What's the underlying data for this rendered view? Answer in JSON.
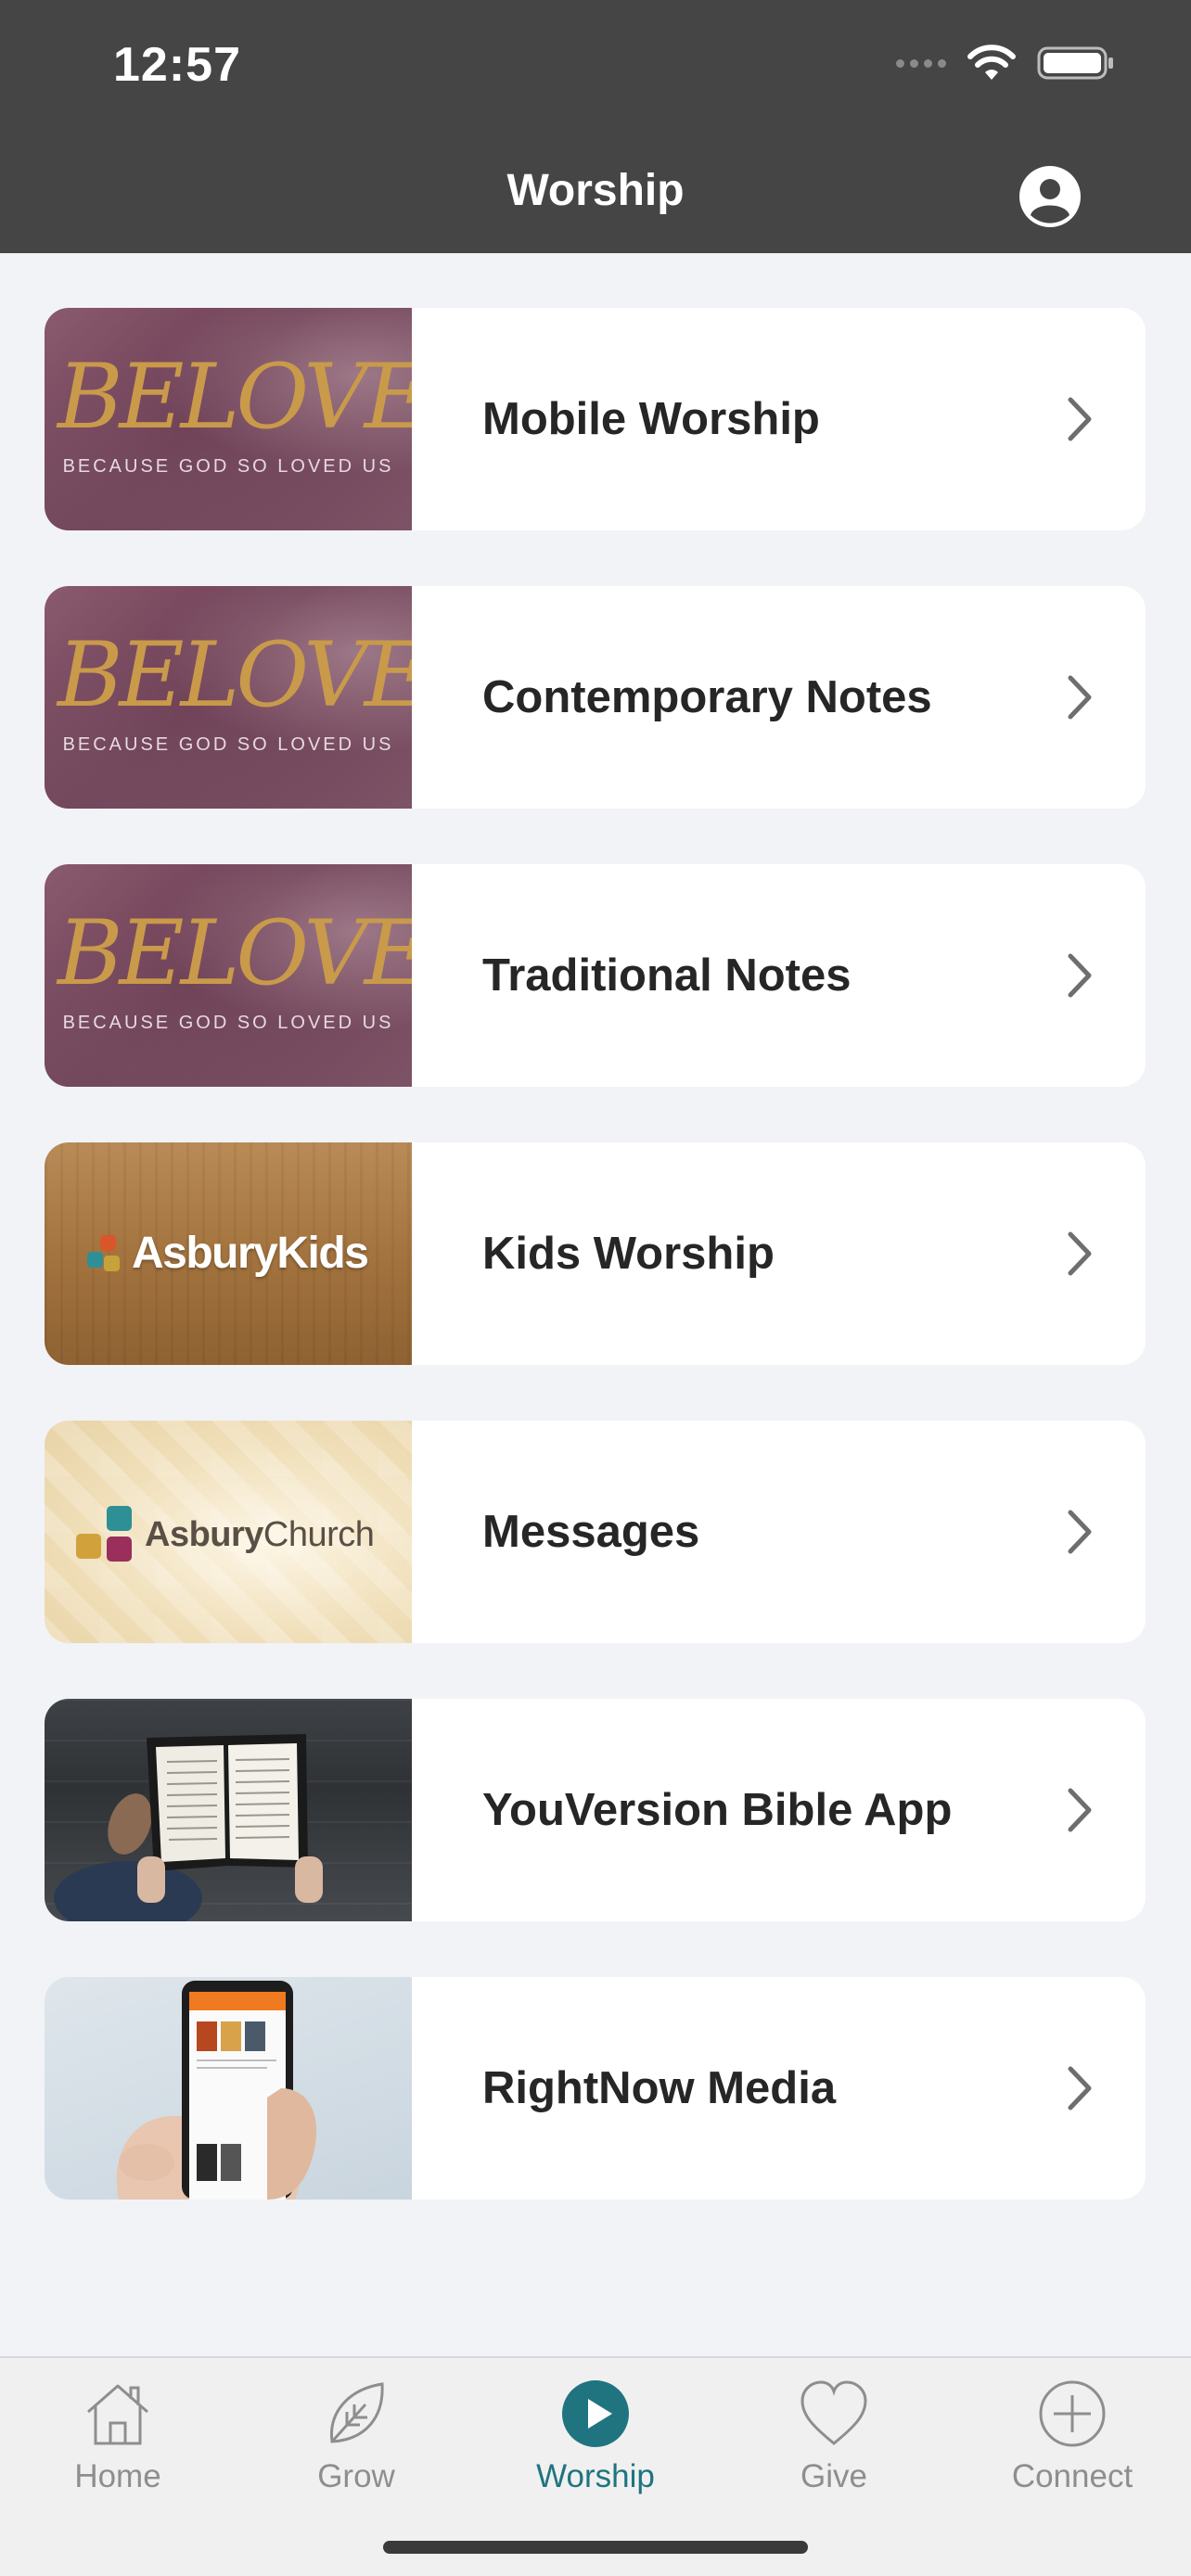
{
  "status_bar": {
    "time": "12:57"
  },
  "header": {
    "title": "Worship"
  },
  "items": [
    {
      "label": "Mobile Worship",
      "thumb": {
        "kind": "beloved",
        "title": "BELOVED",
        "subtitle": "BECAUSE GOD SO LOVED US"
      }
    },
    {
      "label": "Contemporary Notes",
      "thumb": {
        "kind": "beloved",
        "title": "BELOVED",
        "subtitle": "BECAUSE GOD SO LOVED US"
      }
    },
    {
      "label": "Traditional Notes",
      "thumb": {
        "kind": "beloved",
        "title": "BELOVED",
        "subtitle": "BECAUSE GOD SO LOVED US"
      }
    },
    {
      "label": "Kids Worship",
      "thumb": {
        "kind": "kids",
        "logo_text": "AsburyKids"
      }
    },
    {
      "label": "Messages",
      "thumb": {
        "kind": "church",
        "logo_bold": "Asbury",
        "logo_regular": "Church"
      }
    },
    {
      "label": "YouVersion Bible App",
      "thumb": {
        "kind": "photo-open-bible"
      }
    },
    {
      "label": "RightNow Media",
      "thumb": {
        "kind": "photo-phone-app"
      }
    }
  ],
  "tabs": [
    {
      "label": "Home",
      "icon": "house-icon",
      "active": false
    },
    {
      "label": "Grow",
      "icon": "leaf-icon",
      "active": false
    },
    {
      "label": "Worship",
      "icon": "play-circle-icon",
      "active": true
    },
    {
      "label": "Give",
      "icon": "heart-icon",
      "active": false
    },
    {
      "label": "Connect",
      "icon": "plus-circle-icon",
      "active": false
    }
  ],
  "colors": {
    "header_bg": "#454545",
    "page_bg": "#f2f3f7",
    "accent": "#1f7480",
    "tab_inactive": "#8e8e8e"
  }
}
